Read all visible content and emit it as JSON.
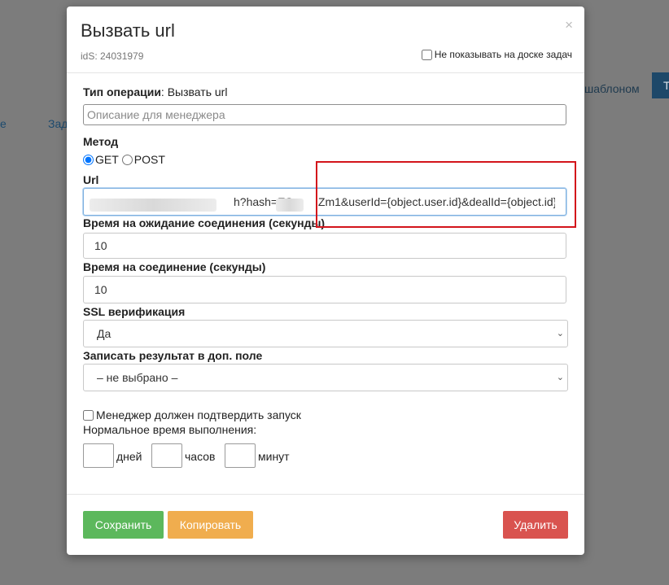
{
  "background": {
    "left_text_1": "е",
    "left_text_2": "Зад",
    "template_text": "шаблоном",
    "button_text": "Т"
  },
  "modal": {
    "title": "Вызвать url",
    "id_label": "idS: 24031979",
    "close_symbol": "×",
    "hide_board_label": "Не показывать на доске задач",
    "hide_board_checked": false
  },
  "form": {
    "operation_type": {
      "label": "Тип операции",
      "value": ": Вызвать url"
    },
    "description": {
      "value": "",
      "placeholder": "Описание для менеджера"
    },
    "method": {
      "label": "Метод",
      "options": [
        "GET",
        "POST"
      ],
      "selected": "GET"
    },
    "url": {
      "label": "Url",
      "visible_value": "h?hash=ES        Zm1&userId={object.user.id}&dealId={object.id}"
    },
    "connect_wait_timeout": {
      "label": "Время на ожидание соединения (секунды)",
      "value": "10"
    },
    "connect_timeout": {
      "label": "Время на соединение (секунды)",
      "value": "10"
    },
    "ssl_verify": {
      "label": "SSL верификация",
      "selected": "Да"
    },
    "write_result": {
      "label": "Записать результат в доп. поле",
      "selected": "– не выбрано –"
    },
    "manager_confirm": {
      "label": "Менеджер должен подтвердить запуск",
      "checked": false
    },
    "normal_time": {
      "label": "Нормальное время выполнения:",
      "days_label": "дней",
      "hours_label": "часов",
      "minutes_label": "минут",
      "days": "",
      "hours": "",
      "minutes": ""
    }
  },
  "buttons": {
    "save": "Сохранить",
    "copy": "Копировать",
    "delete": "Удалить"
  },
  "colors": {
    "save": "#5cb85c",
    "copy": "#f0ad4e",
    "delete": "#d9534f",
    "highlight": "#d3141b",
    "backdrop": "#7c7c7c"
  }
}
